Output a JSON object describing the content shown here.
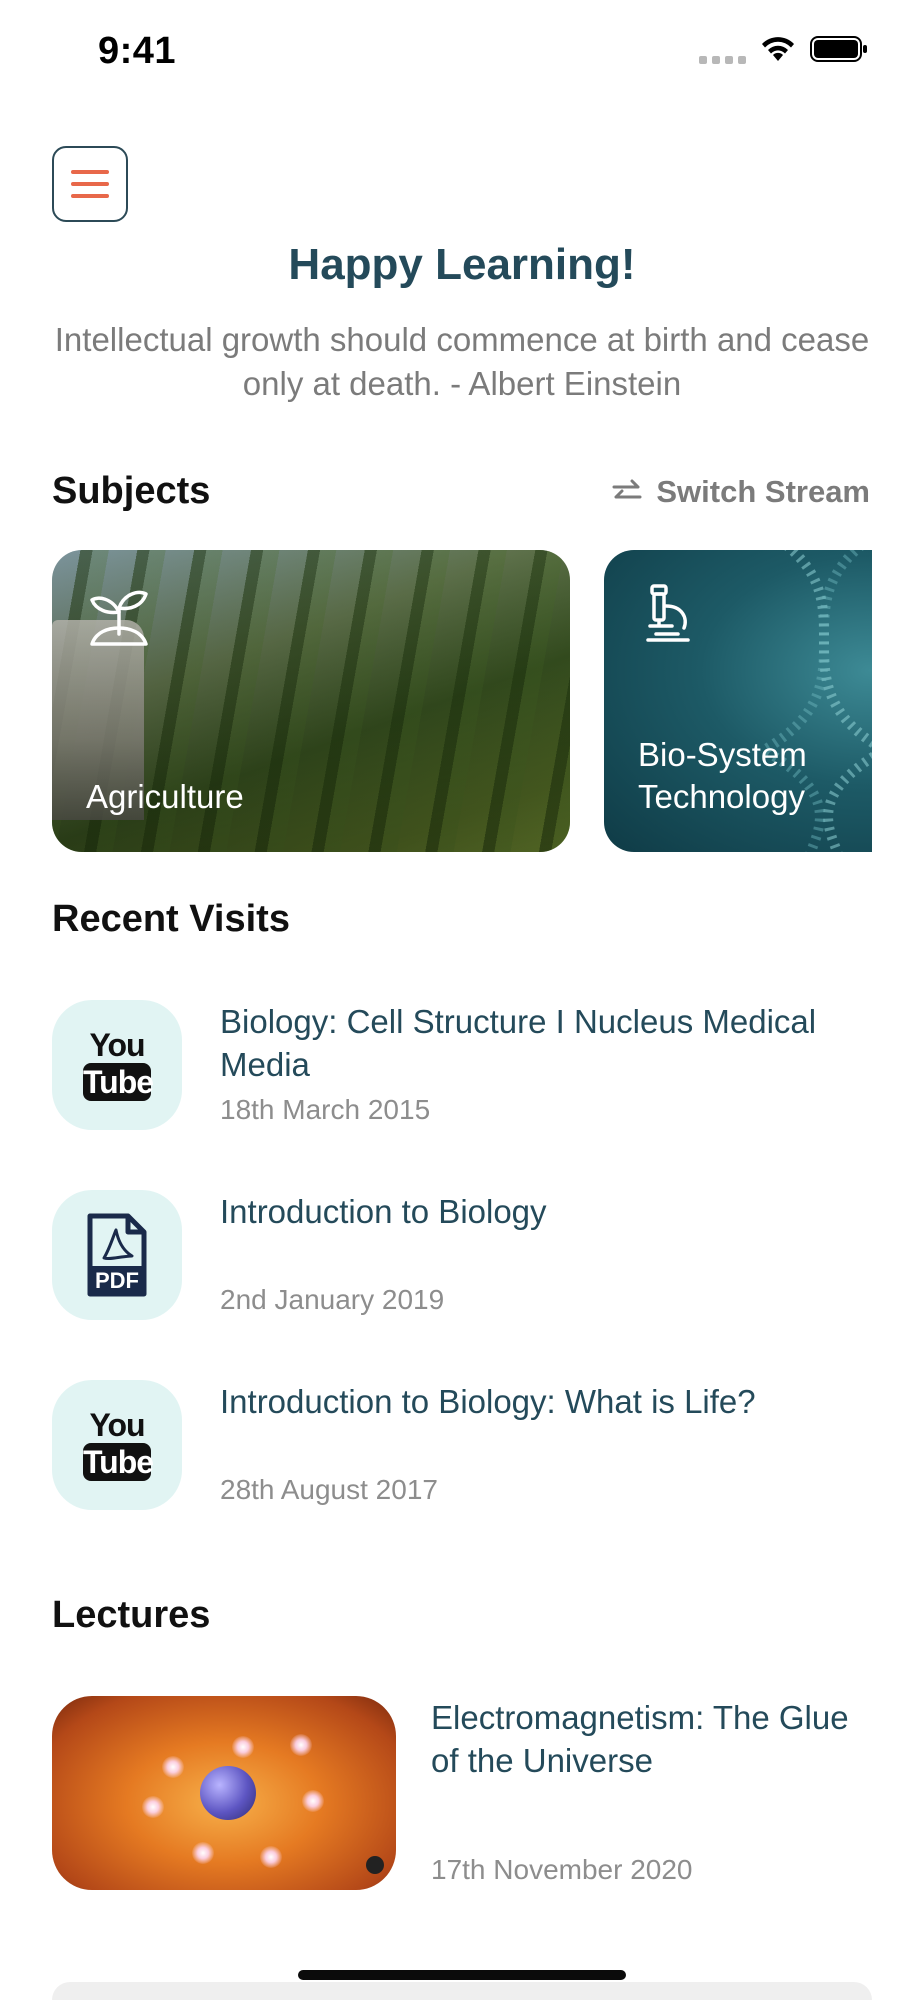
{
  "status_bar": {
    "time": "9:41",
    "icons": [
      "signal-icon",
      "wifi-icon",
      "battery-icon"
    ]
  },
  "header": {
    "menu_icon": "hamburger-menu-icon",
    "headline": "Happy Learning!",
    "quote": "Intellectual growth should commence at birth and cease only at death. - Albert Einstein"
  },
  "subjects": {
    "title": "Subjects",
    "switch_stream_label": "Switch Stream",
    "switch_stream_icon": "swap-arrows-icon",
    "items": [
      {
        "label": "Agriculture",
        "icon": "sprout-icon"
      },
      {
        "label": "Bio-System Technology",
        "icon": "microscope-icon"
      }
    ]
  },
  "recent_visits": {
    "title": "Recent Visits",
    "items": [
      {
        "type": "youtube",
        "icon": "youtube-icon",
        "title": "Biology: Cell Structure I Nucleus Medical Media",
        "date": "18th March 2015"
      },
      {
        "type": "pdf",
        "icon": "pdf-icon",
        "title": "Introduction to Biology",
        "date": "2nd January 2019"
      },
      {
        "type": "youtube",
        "icon": "youtube-icon",
        "title": "Introduction to Biology: What is Life?",
        "date": "28th August 2017"
      }
    ],
    "youtube_you": "You",
    "youtube_tube": "Tube",
    "pdf_label": "PDF"
  },
  "lectures": {
    "title": "Lectures",
    "items": [
      {
        "title": "Electromagnetism: The Glue of the Universe",
        "date": "17th November 2020"
      }
    ]
  },
  "colors": {
    "accent": "#e8684a",
    "heading": "#244a5a",
    "muted": "#7b7b7b",
    "icon_bg": "#e1f4f3"
  }
}
